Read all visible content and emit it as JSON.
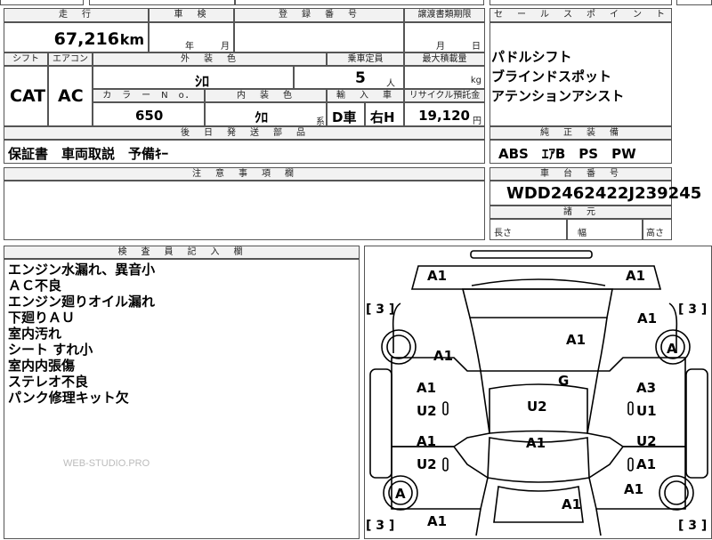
{
  "top": {
    "mileage_header": "走　行",
    "mileage": "67,216",
    "mileage_unit": "km",
    "inspection_header": "車　検",
    "inspection_year": "年",
    "inspection_month": "月",
    "registration_header": "登　録　番　号",
    "transfer_header": "譲渡書類期限",
    "transfer_month": "月",
    "transfer_day": "日"
  },
  "row2": {
    "shift_header": "シフト",
    "shift": "CAT",
    "aircon_header": "エアコン",
    "aircon": "AC",
    "exterior_header": "外　装　色",
    "exterior_color": "ｼﾛ",
    "capacity_header": "乗車定員",
    "capacity": "5",
    "capacity_unit": "人",
    "max_load_header": "最大積載量",
    "max_load_unit": "kg",
    "color_no_header": "カ　ラ　ー　N　o．",
    "color_no": "650",
    "interior_header": "内　装　色",
    "interior_color": "ｸﾛ",
    "interior_suffix": "系",
    "import_header": "輸　入　車",
    "import_drive": "D車",
    "import_steer": "右H",
    "recycle_header": "リサイクル預託金",
    "recycle": "19,120",
    "recycle_unit": "円"
  },
  "sales": {
    "header": "セ　ー　ル　ス　ポ　イ　ン　ト",
    "lines": [
      "パドルシフト",
      "ブラインドスポット",
      "アテンションアシスト"
    ]
  },
  "parts": {
    "header": "後　日　発　送　部　品",
    "value": "保証書　車両取説　予備ｷｰ"
  },
  "equip": {
    "header": "純　正　装　備",
    "value": "ABS　ｴｱB　PS　PW"
  },
  "caution": {
    "header": "注　意　事　項　欄"
  },
  "chassis": {
    "header": "車　台　番　号",
    "vin": "WDD2462422J239245"
  },
  "dims": {
    "header": "諸　元",
    "length": "長さ",
    "width": "幅",
    "height": "高さ"
  },
  "inspector": {
    "header": "検　査　員　記　入　欄",
    "notes": [
      "エンジン水漏れ、異音小",
      "ＡＣ不良",
      "エンジン廻りオイル漏れ",
      "下廻りＡＵ",
      "室内汚れ",
      "シート すれ小",
      "室内内張傷",
      "ステレオ不良",
      "パンク修理キット欠"
    ],
    "watermark": "WEB-STUDIO.PRO"
  },
  "diagram": {
    "marks": {
      "front_bumper_left": "A1",
      "front_bumper_right": "A1",
      "front_fender_left": "A1",
      "front_fender_right": "A1",
      "bonnet": "A1",
      "front_wheel_right": "A",
      "roof": "G",
      "front_door_left_top": "A1",
      "front_door_left_bottom": "U2",
      "front_door_right_top": "A3",
      "front_door_right_bottom": "U1",
      "interior_upper": "U2",
      "interior_lower": "A1",
      "rear_door_left_top": "A1",
      "rear_door_left_bottom": "U2",
      "rear_door_right_top": "U2",
      "rear_door_right_bottom": "A1",
      "rear_wheel_left": "A",
      "rear_fender_right": "A1",
      "trunk": "A1",
      "rear_bumper": "A1",
      "tire_fl": "3",
      "tire_fr": "3",
      "tire_rl": "3",
      "tire_rr": "3"
    }
  }
}
